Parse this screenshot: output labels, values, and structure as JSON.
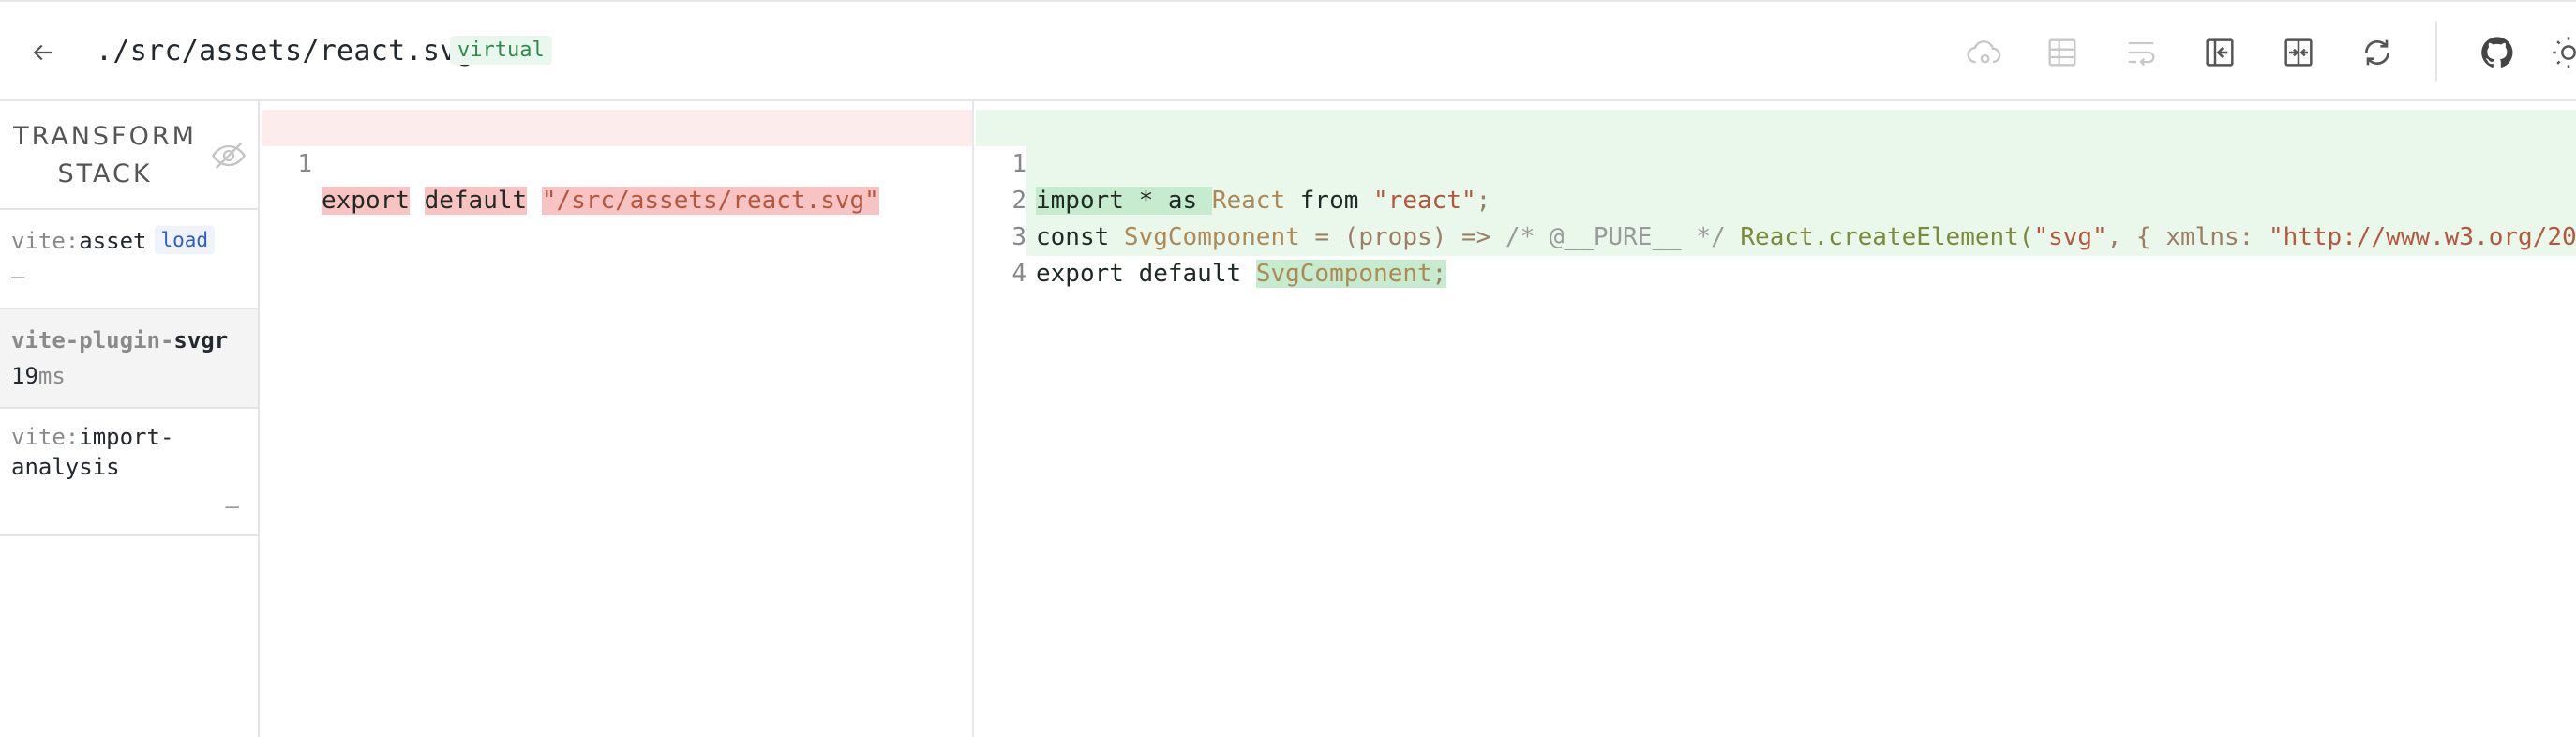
{
  "header": {
    "file_path": "./src/assets/react.svg",
    "badge": "virtual",
    "icons": [
      "back-arrow-icon",
      "cloud-settings-icon",
      "table-icon",
      "wrap-text-icon",
      "collapse-left-icon",
      "diff-split-icon",
      "refresh-icon",
      "github-icon",
      "sun-icon"
    ]
  },
  "sidebar": {
    "title_line1": "TRANSFORM",
    "title_line2": "STACK",
    "items": [
      {
        "prefix": "vite:",
        "name": "asset",
        "badge": "load",
        "time": "–"
      },
      {
        "prefix": "vite-plugin-",
        "name": "svgr",
        "time_value": "19",
        "time_unit": "ms"
      },
      {
        "prefix": "vite:",
        "name_line1": "import-",
        "name_line2": "analysis",
        "time": "–"
      }
    ]
  },
  "left_editor": {
    "lines": [
      {
        "num": "1",
        "parts": [
          "export",
          " ",
          "default",
          " ",
          "\"/src/assets/react.svg\""
        ]
      }
    ]
  },
  "right_editor": {
    "lines": [
      {
        "num": "1",
        "parts": [
          "import",
          " * as ",
          "React",
          " from ",
          "\"react\"",
          ";"
        ]
      },
      {
        "num": "2",
        "parts": [
          "const ",
          "SvgComponent",
          " = (props) => ",
          "/* @__PURE__ */",
          " ",
          "React.createElement(",
          "\"svg\"",
          ", { xmlns: ",
          "\"http://www.w3.org/20"
        ]
      },
      {
        "num": "3",
        "parts": [
          "export default ",
          "SvgComponent",
          ";"
        ]
      },
      {
        "num": "4",
        "parts": []
      }
    ]
  },
  "colors": {
    "removed_bg": "#fdecec",
    "added_bg": "#eaf8ec",
    "badge_green": "#2f8a4a",
    "badge_blue": "#2f5bd1"
  }
}
